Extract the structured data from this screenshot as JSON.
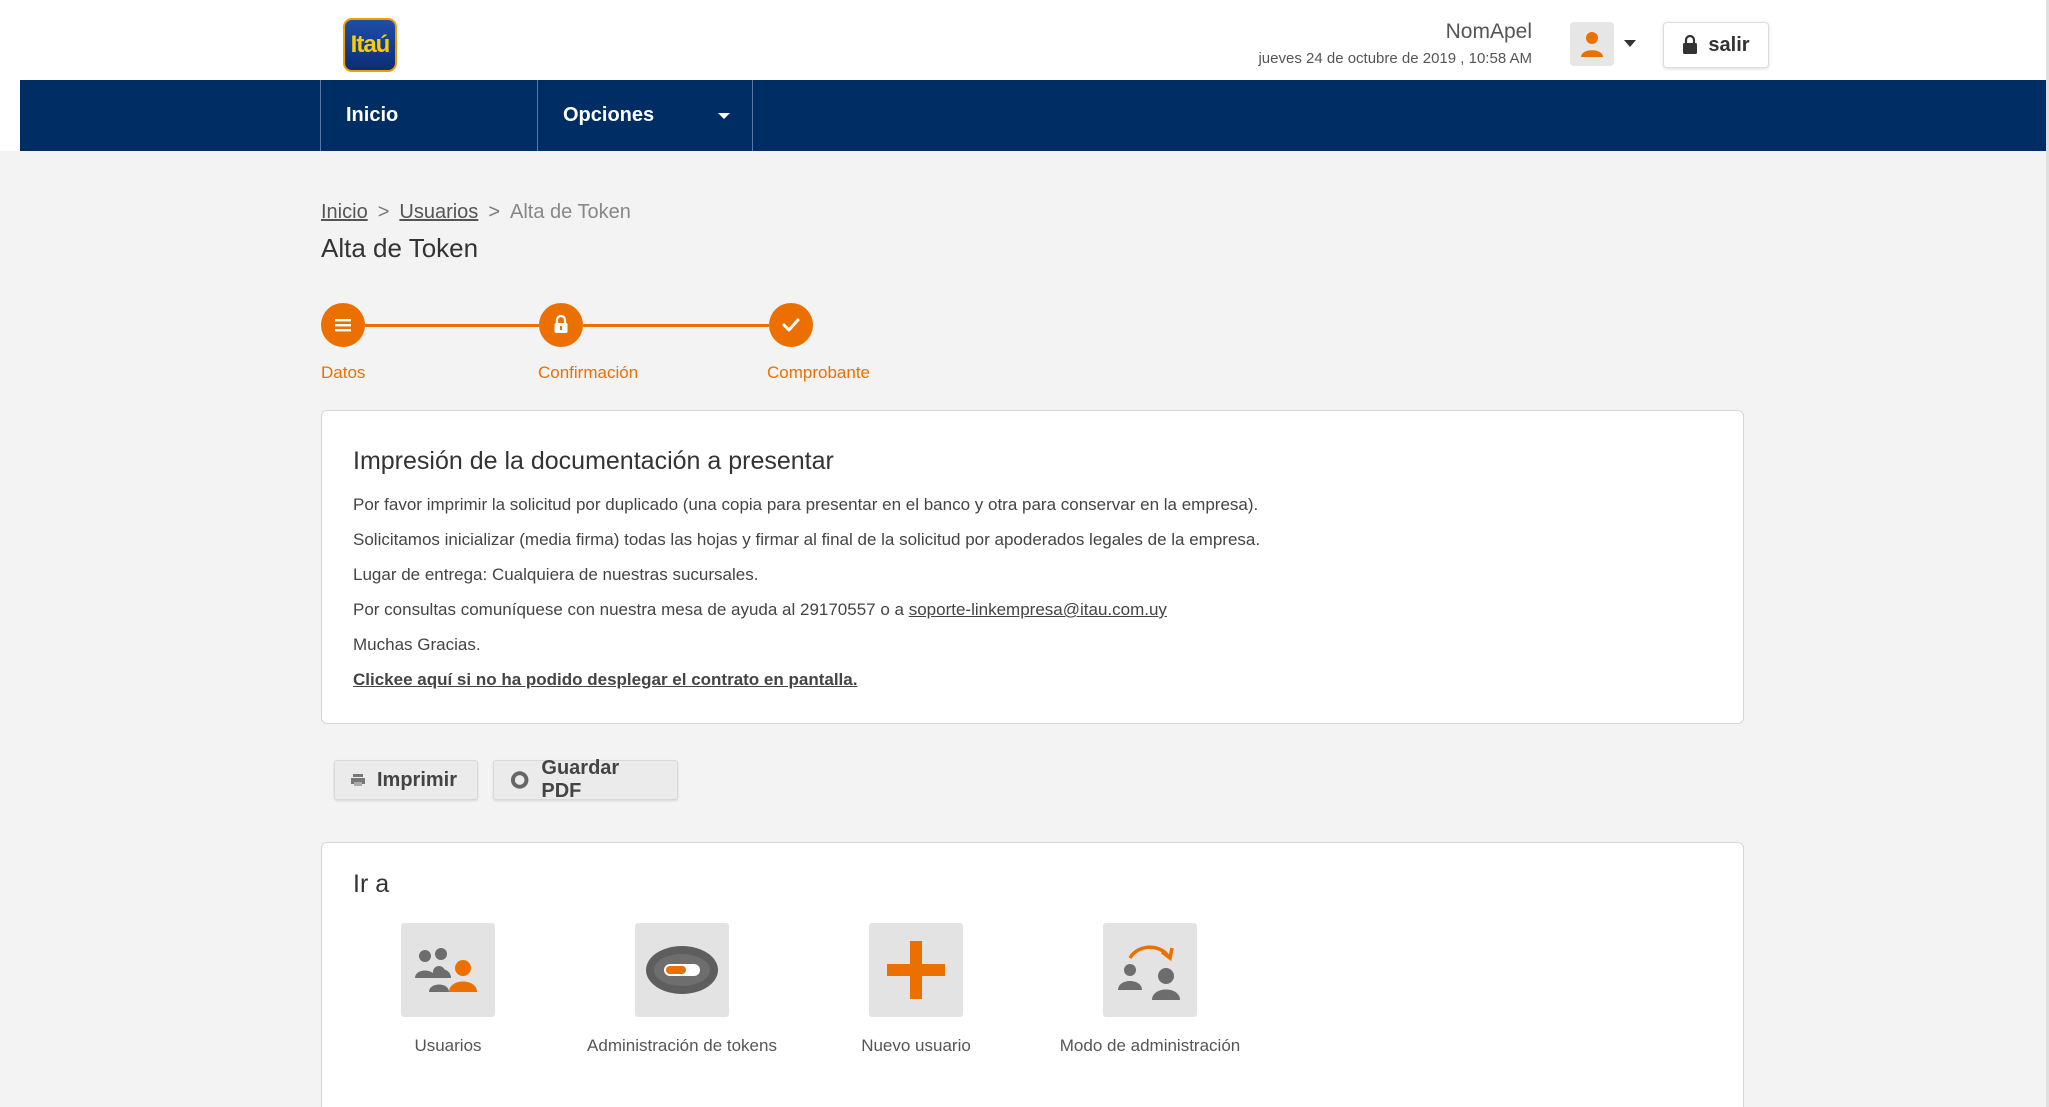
{
  "header": {
    "logo_text": "Itaú",
    "user_name": "NomApel",
    "date": "jueves 24 de octubre de 2019 , 10:58 AM",
    "logout_label": "salir"
  },
  "nav": {
    "items": [
      {
        "label": "Inicio"
      },
      {
        "label": "Opciones"
      }
    ]
  },
  "breadcrumb": {
    "items": [
      "Inicio",
      "Usuarios",
      "Alta de Token"
    ],
    "separator": ">"
  },
  "page_title": "Alta de Token",
  "stepper": {
    "steps": [
      {
        "label": "Datos",
        "icon": "list-icon"
      },
      {
        "label": "Confirmación",
        "icon": "lock-icon"
      },
      {
        "label": "Comprobante",
        "icon": "check-icon"
      }
    ],
    "color": "#ec7000"
  },
  "document": {
    "title": "Impresión de la documentación a presentar",
    "line1": "Por favor imprimir la solicitud por duplicado (una copia para presentar en el banco y otra para conservar en la empresa).",
    "line2": "Solicitamos inicializar (media firma) todas las hojas y firmar al final de la solicitud por apoderados legales de la empresa.",
    "line3": "Lugar de entrega: Cualquiera de nuestras sucursales.",
    "line4_text": "Por consultas comuníquese con nuestra mesa de ayuda al 29170557 o a ",
    "line4_link": "soporte-linkempresa@itau.com.uy",
    "line5": "Muchas Gracias.",
    "contract_link": "Clickee aquí si no ha podido desplegar el contrato en pantalla."
  },
  "actions": {
    "print_label": "Imprimir",
    "pdf_label": "Guardar PDF"
  },
  "goto": {
    "title": "Ir a",
    "tiles": [
      {
        "label": "Usuarios",
        "icon": "users-icon"
      },
      {
        "label": "Administración de tokens",
        "icon": "token-icon"
      },
      {
        "label": "Nuevo usuario",
        "icon": "plus-icon"
      },
      {
        "label": "Modo de administración",
        "icon": "switch-admin-icon"
      }
    ]
  },
  "colors": {
    "brand_navy": "#002d64",
    "accent_orange": "#ec7000"
  }
}
